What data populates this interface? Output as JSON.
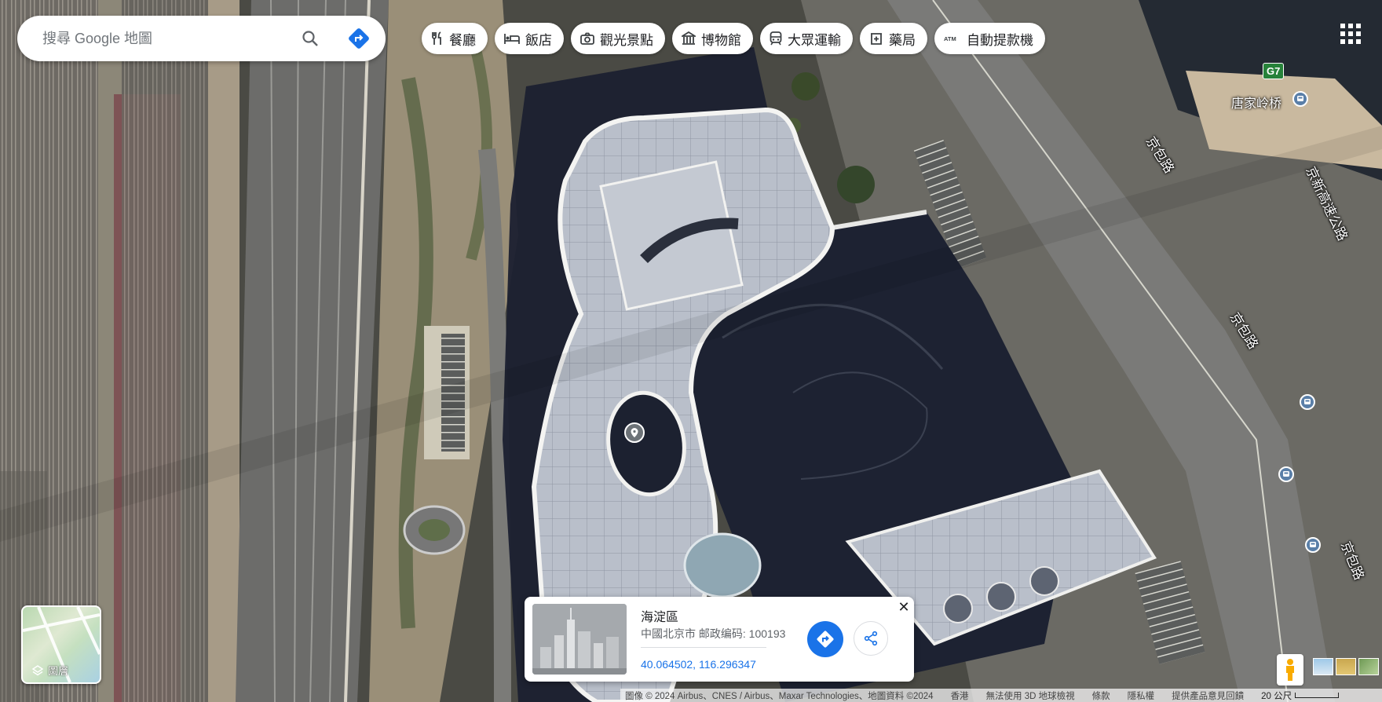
{
  "search": {
    "placeholder": "搜尋 Google 地圖"
  },
  "chips": [
    {
      "label": "餐廳",
      "icon": "restaurant-icon"
    },
    {
      "label": "飯店",
      "icon": "hotel-icon"
    },
    {
      "label": "觀光景點",
      "icon": "camera-icon"
    },
    {
      "label": "博物館",
      "icon": "museum-icon"
    },
    {
      "label": "大眾運輸",
      "icon": "transit-icon"
    },
    {
      "label": "藥局",
      "icon": "pharmacy-icon"
    },
    {
      "label": "自動提款機",
      "icon": "atm-icon"
    }
  ],
  "map": {
    "road_labels": {
      "jingbao_1": "京包路",
      "jingbao_2": "京包路",
      "jingbao_3": "京包路",
      "jingxin": "京新高速公路"
    },
    "place": "唐家岭桥",
    "shield": "G7"
  },
  "layers": {
    "label": "圖層"
  },
  "card": {
    "title": "海淀區",
    "address": "中國北京市 邮政编码: 100193",
    "coordinates": "40.064502, 116.296347"
  },
  "footer": {
    "imagery": "圖像 © 2024 Airbus、CNES / Airbus、Maxar Technologies、地圖資料 ©2024",
    "region": "香港",
    "no3d": "無法使用 3D 地球檢視",
    "terms": "條款",
    "privacy": "隱私權",
    "feedback": "提供產品意見回饋",
    "scale": "20 公尺"
  },
  "colors": {
    "accent": "#1a73e8",
    "satellite_dark": "#1e2433"
  }
}
